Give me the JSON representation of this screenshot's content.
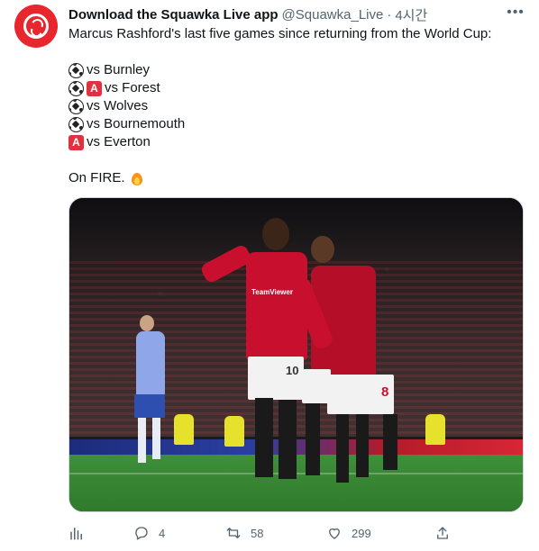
{
  "tweet": {
    "display_name": "Download the Squawka Live app",
    "handle": "@Squawka_Live",
    "separator": "·",
    "time": "4시간",
    "more_label": "•••",
    "intro": "Marcus Rashford's last five games since returning from the World Cup:",
    "games": [
      {
        "icons": [
          "soccer-ball-icon"
        ],
        "text": "vs Burnley"
      },
      {
        "icons": [
          "soccer-ball-icon",
          "a-badge-icon"
        ],
        "text": "vs Forest"
      },
      {
        "icons": [
          "soccer-ball-icon"
        ],
        "text": "vs Wolves"
      },
      {
        "icons": [
          "soccer-ball-icon"
        ],
        "text": "vs Bournemouth"
      },
      {
        "icons": [
          "a-badge-icon"
        ],
        "text": "vs Everton"
      }
    ],
    "badge_letter": "A",
    "closing": "On FIRE.",
    "closing_icon": "fire-icon",
    "shirt_numbers": [
      "10",
      "8"
    ],
    "sponsor": "TeamViewer"
  },
  "actions": {
    "analytics_icon": "analytics-icon",
    "reply_icon": "reply-icon",
    "reply_count": "4",
    "retweet_icon": "retweet-icon",
    "retweet_count": "58",
    "like_icon": "heart-icon",
    "like_count": "299",
    "share_icon": "share-icon"
  },
  "colors": {
    "brand_red": "#e8262d",
    "secondary_text": "#536471",
    "primary_text": "#0f1419",
    "badge_red": "#e0313e"
  }
}
